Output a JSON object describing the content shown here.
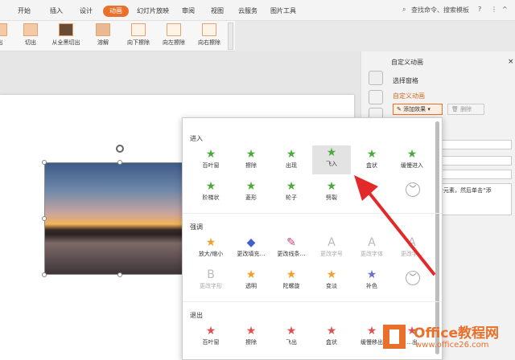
{
  "menu": {
    "items": [
      "开始",
      "插入",
      "设计",
      "动画",
      "幻灯片放映",
      "审阅",
      "视图",
      "云服务",
      "图片工具"
    ],
    "active_index": 3,
    "search": "查找命令、搜索模板",
    "help": "?",
    "more": "⋮"
  },
  "ribbon": {
    "buttons": [
      "出",
      "切出",
      "从全黑切出",
      "溶解",
      "向下擦除",
      "向左擦除",
      "向右擦除"
    ]
  },
  "right_panel": {
    "header": "自定义动画",
    "select_pane": "选择窗格",
    "custom_anim": "自定义动画",
    "add_effect": "添加效果",
    "delete": "删除",
    "hint": "个元素，然后单击“添"
  },
  "dropdown": {
    "enter_title": "进入",
    "enter_row1": [
      "百叶窗",
      "擦除",
      "出现",
      "飞入",
      "盒状",
      "缓慢进入"
    ],
    "enter_row2": [
      "阶梯状",
      "菱形",
      "轮子",
      "劈裂"
    ],
    "emphasis_title": "强调",
    "emphasis_row1": [
      "放大/缩小",
      "更改填充…",
      "更改线条…",
      "更改字号",
      "更改字体",
      "更改字…"
    ],
    "emphasis_row2": [
      "更改字形",
      "透明",
      "陀螺旋",
      "变淡",
      "补色"
    ],
    "exit_title": "退出",
    "exit_row1": [
      "百叶窗",
      "擦除",
      "飞出",
      "盒状",
      "缓慢移出",
      "…出"
    ]
  },
  "colors": {
    "accent": "#e8702a",
    "star_green": "#4caa3d",
    "star_orange": "#f0a030",
    "star_red": "#e05050"
  },
  "watermark": {
    "brand": "Office教程网",
    "url": "www.office26.com"
  }
}
